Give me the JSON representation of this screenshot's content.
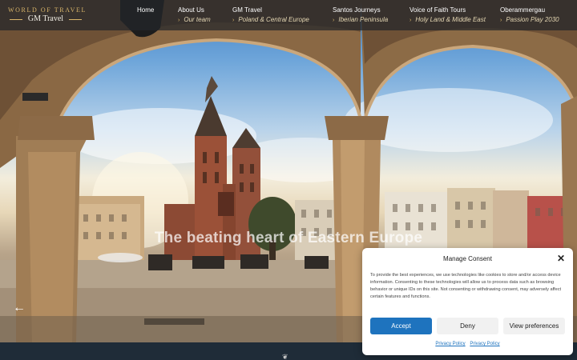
{
  "brand": {
    "line1": "WORLD OF TRAVEL",
    "line2": "GM Travel"
  },
  "nav": {
    "items": [
      {
        "label": "Home",
        "sub": ""
      },
      {
        "label": "About Us",
        "sub": "Our team"
      },
      {
        "label": "GM Travel",
        "sub": "Poland & Central Europe"
      },
      {
        "label": "Santos Journeys",
        "sub": "Iberian Peninsula"
      },
      {
        "label": "Voice of Faith Tours",
        "sub": "Holy Land & Middle East"
      },
      {
        "label": "Oberammergau",
        "sub": "Passion Play 2030"
      }
    ]
  },
  "hero": {
    "title": "The beating heart of Eastern Europe",
    "prev_arrow": "←"
  },
  "consent": {
    "title": "Manage Consent",
    "close": "✕",
    "text": "To provide the best experiences, we use technologies like cookies to store and/or access device information. Consenting to these technologies will allow us to process data such as browsing behavior or unique IDs on this site. Not consenting or withdrawing consent, may adversely affect certain features and functions.",
    "accept": "Accept",
    "deny": "Deny",
    "preferences": "View preferences",
    "link1": "Privacy Policy",
    "link2": "Privacy Policy"
  },
  "colors": {
    "accent": "#1e73be",
    "gold": "#d9b56a",
    "footer": "#1f2c38"
  }
}
